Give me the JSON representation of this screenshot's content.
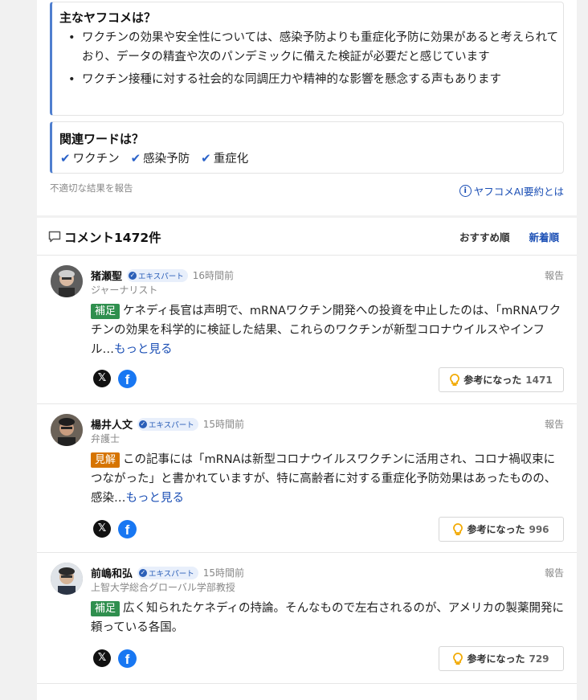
{
  "summary": {
    "title": "主なヤフコメは？",
    "bullets": [
      "ワクチンの効果や安全性については、感染予防よりも重症化予防に効果があると考えられており、データの精査や次のパンデミックに備えた検証が必要だと感じています",
      "ワクチン接種に対する社会的な同調圧力や精神的な影響を懸念する声もあります"
    ],
    "bullet_char": "•"
  },
  "related": {
    "title": "関連ワードは？",
    "words": [
      "ワクチン",
      "感染予防",
      "重症化"
    ],
    "check_icon": "check-icon"
  },
  "report_inappropriate": "不適切な結果を報告",
  "about_ai": "ヤフコメAI要約とは",
  "comments_header": {
    "title": "コメント1472件",
    "sort_recommended": "おすすめ順",
    "sort_newest": "新着順"
  },
  "comments": [
    {
      "name": "猪瀬聖",
      "badge": "エキスパート",
      "time": "16時間前",
      "role": "ジャーナリスト",
      "report": "報告",
      "tag": "補足",
      "tag_color": "#2f8f4e",
      "text": "ケネディ長官は声明で、mRNAワクチン開発への投資を中止したのは、「mRNAワクチンの効果を科学的に検証した結果、これらのワクチンが新型コロナウイルスやインフル…",
      "more": "もっと見る",
      "helpful_label": "参考になった",
      "helpful_count": "1471"
    },
    {
      "name": "楊井人文",
      "badge": "エキスパート",
      "time": "15時間前",
      "role": "弁護士",
      "report": "報告",
      "tag": "見解",
      "tag_color": "#d67400",
      "text": "この記事には「mRNAは新型コロナウイルスワクチンに活用され、コロナ禍収束につながった」と書かれていますが、特に高齢者に対する重症化予防効果はあったものの、感染…",
      "more": "もっと見る",
      "helpful_label": "参考になった",
      "helpful_count": "996"
    },
    {
      "name": "前嶋和弘",
      "badge": "エキスパート",
      "time": "15時間前",
      "role": "上智大学総合グローバル学部教授",
      "report": "報告",
      "tag": "補足",
      "tag_color": "#2f8f4e",
      "text": "広く知られたケネディの持論。そんなもので左右されるのが、アメリカの製薬開発に頼っている各国。",
      "more": "",
      "helpful_label": "参考になった",
      "helpful_count": "729"
    }
  ],
  "social": {
    "x_glyph": "𝕏",
    "fb_glyph": "f"
  }
}
